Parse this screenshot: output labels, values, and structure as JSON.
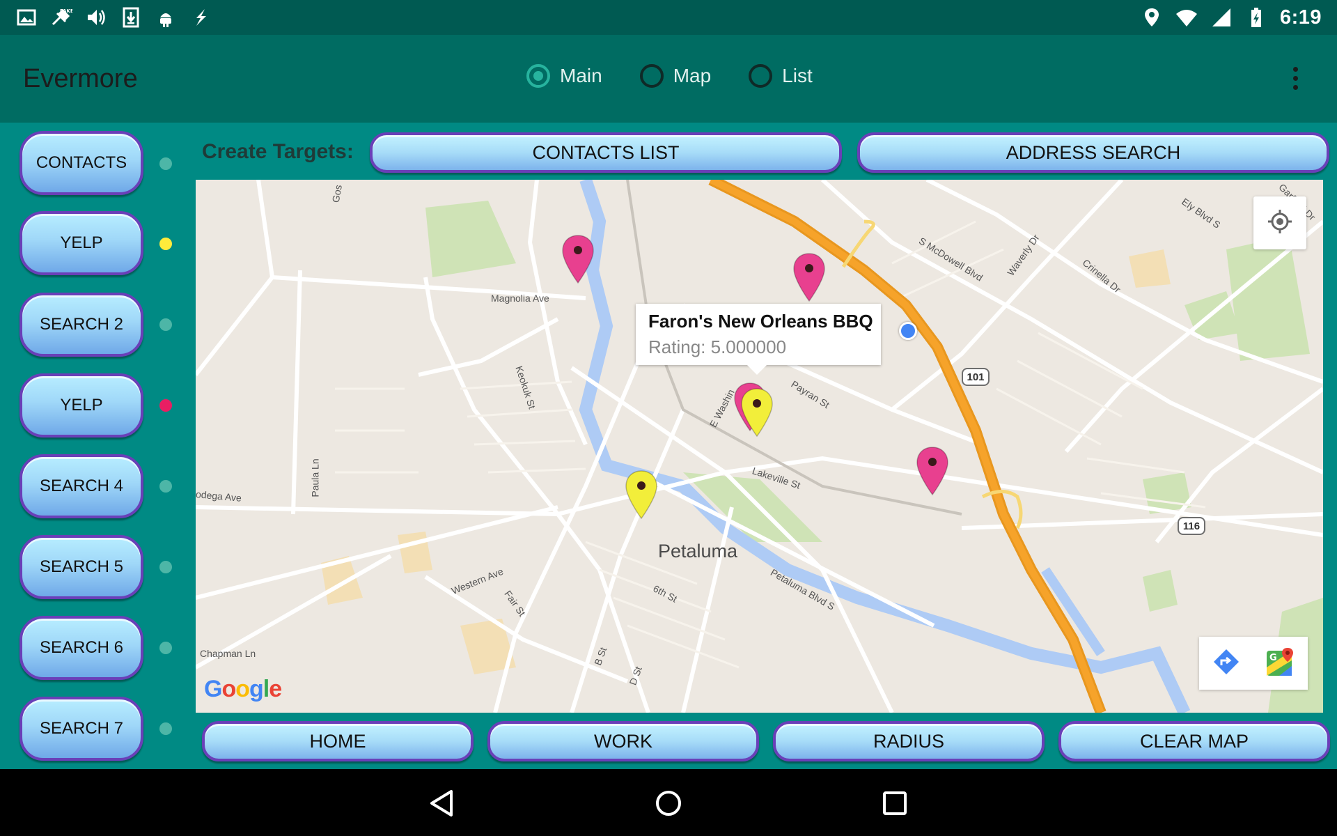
{
  "status_bar": {
    "time": "6:19",
    "left_icons": [
      "image-icon",
      "fake-gps-icon",
      "volume-icon",
      "download-icon",
      "android-icon",
      "flash-icon"
    ],
    "right_icons": [
      "location-icon",
      "wifi-icon",
      "cell-signal-icon",
      "battery-charging-icon"
    ]
  },
  "toolbar": {
    "title": "Evermore",
    "tabs": [
      {
        "label": "Main",
        "selected": true
      },
      {
        "label": "Map",
        "selected": false
      },
      {
        "label": "List",
        "selected": false
      }
    ],
    "overflow_icon": "more-vert-icon"
  },
  "sidebar": {
    "items": [
      {
        "label": "CONTACTS",
        "dot_color": "#4DB6A7"
      },
      {
        "label": "YELP",
        "dot_color": "#FFEB3B"
      },
      {
        "label": "SEARCH 2",
        "dot_color": "#4DB6A7"
      },
      {
        "label": "YELP",
        "dot_color": "#E91E63"
      },
      {
        "label": "SEARCH 4",
        "dot_color": "#4DB6A7"
      },
      {
        "label": "SEARCH 5",
        "dot_color": "#4DB6A7"
      },
      {
        "label": "SEARCH 6",
        "dot_color": "#4DB6A7"
      },
      {
        "label": "SEARCH 7",
        "dot_color": "#4DB6A7"
      }
    ]
  },
  "targets": {
    "label": "Create Targets:",
    "contacts_list": "CONTACTS LIST",
    "address_search": "ADDRESS SEARCH"
  },
  "map": {
    "city": "Petaluma",
    "streets": [
      "Magnolia Ave",
      "Keokuk St",
      "Paula Ln",
      "odega Ave",
      "Western Ave",
      "Fair St",
      "6th St",
      "B St",
      "D St",
      "E Washin",
      "Payran St",
      "Lakeville St",
      "Petaluma Blvd S",
      "S McDowell Blvd",
      "Waverly Dr",
      "Crinella Dr",
      "Ely Blvd S",
      "Chapman Ln",
      "Gos",
      "Garfield Dr"
    ],
    "highways": [
      "101",
      "116"
    ],
    "info_window": {
      "title": "Faron's New Orleans BBQ",
      "rating": "Rating: 5.000000"
    },
    "pin_colors": {
      "magenta": "#E8408F",
      "yellow": "#F2EE3A"
    },
    "attribution": "Google",
    "buttons": [
      "my-location-icon",
      "directions-icon",
      "google-maps-icon"
    ]
  },
  "bottom": {
    "home": "HOME",
    "work": "WORK",
    "radius": "RADIUS",
    "clear": "CLEAR MAP"
  },
  "nav": [
    "back-icon",
    "home-icon",
    "recents-icon"
  ]
}
